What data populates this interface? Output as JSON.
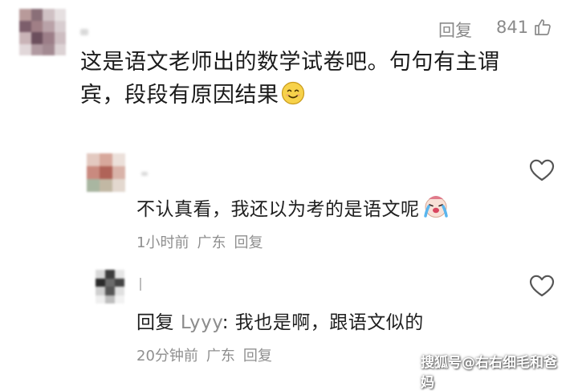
{
  "comment": {
    "text_line1": "这是语文老师出的数学试卷吧。句句有主谓",
    "text_line2": "宾，段段有原因结果",
    "reply_label": "回复",
    "like_count": "841"
  },
  "replies": [
    {
      "text": "不认真看，我还以为考的是语文呢",
      "time": "1小时前",
      "location": "广东",
      "reply_label": "回复"
    },
    {
      "prefix": "回复",
      "mention": "Lyyy",
      "text": ": 我也是啊，跟语文似的",
      "time": "20分钟前",
      "location": "广东",
      "reply_label": "回复"
    }
  ],
  "watermark": "搜狐号@右右细毛和爸妈",
  "icons": {
    "like": "thumbs-up-icon",
    "heart": "heart-outline-icon",
    "emoji_smile": "smiling-face-icon",
    "emoji_cry": "crying-face-icon"
  }
}
